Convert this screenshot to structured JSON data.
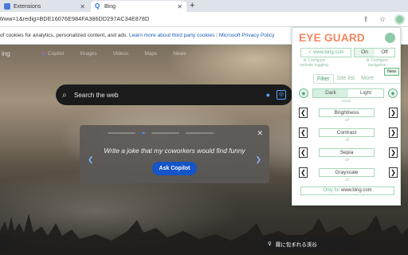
{
  "tabs": [
    {
      "label": "Extensions",
      "favicon": "extensions-favicon-icon"
    },
    {
      "label": "Bing",
      "favicon": "bing-favicon-icon"
    }
  ],
  "address_bar": {
    "url": "Www=1&redig=BDE16076E984FA386DD297AC34E878D"
  },
  "cookie_bar": {
    "text": "of cookies for analytics, personalized content, and ads.",
    "link1": "Learn more about third party cookies",
    "separator": "|",
    "link2": "Microsoft Privacy Policy"
  },
  "bing": {
    "logo": "ing",
    "nav": [
      "Copilot",
      "Images",
      "Videos",
      "Maps",
      "News"
    ],
    "search_placeholder": "Search the web"
  },
  "copilot_card": {
    "prompt": "Write a joke that my coworkers would find funny",
    "button": "Ask Copilot"
  },
  "bottom_bar": {
    "location_text": "霧に包まれる渓谷"
  },
  "eye_guard": {
    "title": "EYE GUARD",
    "domain": "www.bing.com",
    "on_label": "On",
    "off_label": "Off",
    "configure_website_toggling": "Configure website toggling",
    "configure_navigation": "Configure navigation",
    "new_badge": "New",
    "tabs": [
      "Filter",
      "Site list",
      "More"
    ],
    "mode": {
      "dark": "Dark",
      "light": "Light",
      "caption": "Mode"
    },
    "controls": [
      {
        "label": "Brightness",
        "caption": "off"
      },
      {
        "label": "Contrast",
        "caption": "off"
      },
      {
        "label": "Sepia",
        "caption": "off"
      },
      {
        "label": "Grayscale",
        "caption": "off"
      }
    ],
    "only_for_prefix": "Only for",
    "only_for_domain": "www.bing.com"
  },
  "colors": {
    "accent": "#f4845f",
    "green": "#6bb78b",
    "bing_blue": "#1455c7"
  }
}
